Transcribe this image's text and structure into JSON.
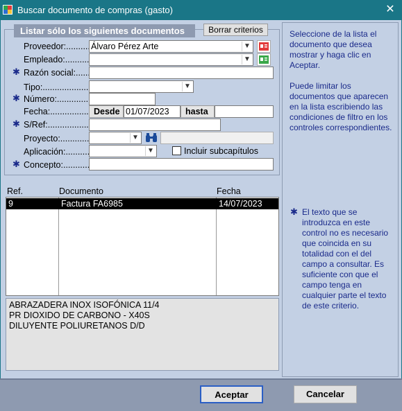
{
  "window": {
    "title": "Buscar documento de compras (gasto)",
    "close_label": "✕"
  },
  "filter": {
    "legend": "Listar sólo los siguientes documentos",
    "clear_button": "Borrar criterios",
    "fields": {
      "proveedor": {
        "label": "Proveedor:...........",
        "value": "Álvaro Pérez Arte"
      },
      "empleado": {
        "label": "Empleado:.............",
        "value": ""
      },
      "razon_social": {
        "label": "Razón social:.........",
        "value": ""
      },
      "tipo": {
        "label": "Tipo:.........................",
        "value": ""
      },
      "numero": {
        "label": "Número:...............",
        "value": ""
      },
      "fecha": {
        "label": "Fecha:......................",
        "desde_label": "Desde",
        "desde_value": "01/07/2023",
        "hasta_label": "hasta",
        "hasta_value": ""
      },
      "sref": {
        "label": "S/Ref:......................",
        "value": ""
      },
      "proyecto": {
        "label": "Proyecto:..................",
        "value": ""
      },
      "aplicacion": {
        "label": "Aplicación:..............",
        "value": "",
        "checkbox_label": "Incluir subcapítulos"
      },
      "concepto": {
        "label": "Concepto:.............",
        "value": ""
      }
    },
    "required_marker": "✱"
  },
  "help": {
    "p1": "Seleccione de la lista el documento que desea mostrar y haga clic en Aceptar.",
    "p2": "Puede limitar los documentos que aparecen en la lista escribiendo las condiciones de filtro en los controles correspondientes.",
    "p3": "El texto que se introduzca en este control no es necesario que coincida en su totalidad con el del campo a consultar. Es suficiente con que el campo tenga en cualquier parte el texto de este criterio."
  },
  "list": {
    "columns": [
      "Ref.",
      "Documento",
      "Fecha"
    ],
    "rows": [
      {
        "ref": "9",
        "documento": "Factura FA6985",
        "fecha": "14/07/2023"
      }
    ]
  },
  "details": [
    "ABRAZADERA INOX ISOFÓNICA 11/4",
    "PR DIOXIDO DE CARBONO - X40S",
    "DILUYENTE POLIURETANOS D/D"
  ],
  "buttons": {
    "accept": "Aceptar",
    "cancel": "Cancelar"
  },
  "colors": {
    "titlebar": "#1a7687",
    "background": "#c3d0e4",
    "help_text": "#1a2a8a",
    "accent_border": "#2a5ec5"
  }
}
